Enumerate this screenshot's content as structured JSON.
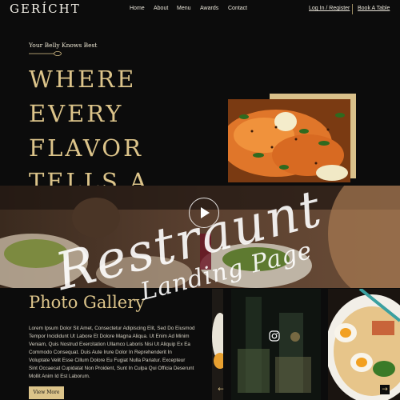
{
  "nav": {
    "logo": "GERÍCHT",
    "links": [
      "Home",
      "About",
      "Menu",
      "Awards",
      "Contact"
    ],
    "login": "Log In / Register",
    "book": "Book A Table"
  },
  "hero": {
    "tagline": "Your Belly Knows Best",
    "headline": [
      "WHERE",
      "EVERY",
      "FLAVOR",
      "TELLS A"
    ]
  },
  "overlay": {
    "line1": "Restraunt",
    "line2": "Landing Page"
  },
  "gallery": {
    "title": "Photo Gallery",
    "body_lines": [
      "Lorem Ipsum Dolor Sit Amet, Consectetur Adipiscing Elit, Sed Do Eiusmod",
      "Tempor Incididunt Ut Labore Et Dolore Magna Aliqua. Ut Enim Ad Minim",
      "Veniam, Quis Nostrud Exercitation Ullamco Laboris Nisi Ut Aliquip Ex Ea",
      "Commodo Consequat. Duis Aute Irure Dolor In Reprehenderit In",
      "Voluptate Velit Esse Cillum Dolore Eu Fugiat Nulla Pariatur. Excepteur",
      "Sint Occaecat Cupidatat Non Proident, Sunt In Culpa Qui Officia Deserunt",
      "Mollit Anim Id Est Laborum."
    ],
    "view_more": "View More",
    "prev_arrow": "←",
    "next_arrow": "→"
  },
  "colors": {
    "accent_gold": "#dcc48a",
    "background": "#0c0c0c"
  },
  "icons": [
    "play-icon",
    "instagram-icon",
    "arrow-left-icon",
    "arrow-right-icon",
    "spoon-icon"
  ]
}
